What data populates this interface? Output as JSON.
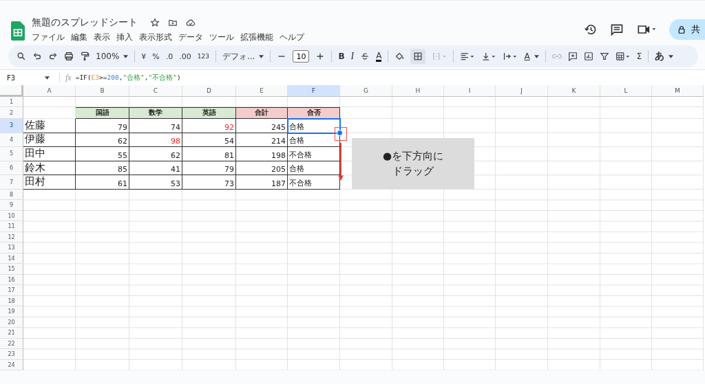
{
  "app": {
    "title": "無題のスプレッドシート",
    "menus": [
      "ファイル",
      "編集",
      "表示",
      "挿入",
      "表示形式",
      "データ",
      "ツール",
      "拡張機能",
      "ヘルプ"
    ],
    "share_label": "共"
  },
  "toolbar": {
    "zoom": "100%",
    "currency": "¥",
    "percent": "%",
    "decrease_decimal": ".0",
    "increase_decimal": ".00",
    "number_format": "123",
    "font": "デフォ...",
    "font_size": "10",
    "bold": "B",
    "italic": "I",
    "text_color": "A",
    "text_rotation": "A",
    "sum": "Σ",
    "input_mode": "あ"
  },
  "formula_bar": {
    "name_box": "F3",
    "fx": "fx",
    "formula": [
      {
        "kind": "plain",
        "text": "=IF("
      },
      {
        "kind": "reference",
        "text": "E3"
      },
      {
        "kind": "plain",
        "text": ">="
      },
      {
        "kind": "number",
        "text": "200"
      },
      {
        "kind": "plain",
        "text": ","
      },
      {
        "kind": "string",
        "text": "\"合格\""
      },
      {
        "kind": "plain",
        "text": ","
      },
      {
        "kind": "string",
        "text": "\"不合格\""
      },
      {
        "kind": "plain",
        "text": ")"
      }
    ]
  },
  "sheet": {
    "columns": [
      {
        "label": "A",
        "selected": false
      },
      {
        "label": "B",
        "selected": false
      },
      {
        "label": "C",
        "selected": false
      },
      {
        "label": "D",
        "selected": false
      },
      {
        "label": "E",
        "selected": false
      },
      {
        "label": "F",
        "selected": true
      },
      {
        "label": "G",
        "selected": false
      },
      {
        "label": "H",
        "selected": false
      },
      {
        "label": "I",
        "selected": false
      },
      {
        "label": "J",
        "selected": false
      },
      {
        "label": "K",
        "selected": false
      },
      {
        "label": "L",
        "selected": false
      },
      {
        "label": "M",
        "selected": false
      }
    ],
    "rows": [
      {
        "label": "1",
        "selected": false
      },
      {
        "label": "2",
        "selected": false
      },
      {
        "label": "3",
        "selected": true
      },
      {
        "label": "4",
        "selected": false
      },
      {
        "label": "5",
        "selected": false
      },
      {
        "label": "6",
        "selected": false
      },
      {
        "label": "7",
        "selected": false
      },
      {
        "label": "8",
        "selected": false
      },
      {
        "label": "9",
        "selected": false
      },
      {
        "label": "10",
        "selected": false
      },
      {
        "label": "11",
        "selected": false
      },
      {
        "label": "12",
        "selected": false
      },
      {
        "label": "13",
        "selected": false
      },
      {
        "label": "14",
        "selected": false
      },
      {
        "label": "15",
        "selected": false
      },
      {
        "label": "16",
        "selected": false
      },
      {
        "label": "17",
        "selected": false
      },
      {
        "label": "18",
        "selected": false
      },
      {
        "label": "19",
        "selected": false
      },
      {
        "label": "20",
        "selected": false
      },
      {
        "label": "21",
        "selected": false
      },
      {
        "label": "22",
        "selected": false
      },
      {
        "label": "23",
        "selected": false
      },
      {
        "label": "24",
        "selected": false
      }
    ],
    "header": [
      {
        "label": "国語",
        "color": "#d9ead3"
      },
      {
        "label": "数学",
        "color": "#d9ead3"
      },
      {
        "label": "英語",
        "color": "#d9ead3"
      },
      {
        "label": "合計",
        "color": "#f4cccc"
      },
      {
        "label": "合否",
        "color": "#f4cccc"
      }
    ],
    "records": [
      {
        "name": "佐藤",
        "scores": [
          {
            "value": "79",
            "flagged": false
          },
          {
            "value": "74",
            "flagged": false
          },
          {
            "value": "92",
            "flagged": true
          }
        ],
        "total": "245",
        "result": {
          "value": "合格",
          "selected": true
        }
      },
      {
        "name": "伊藤",
        "scores": [
          {
            "value": "62",
            "flagged": false
          },
          {
            "value": "98",
            "flagged": true
          },
          {
            "value": "54",
            "flagged": false
          }
        ],
        "total": "214",
        "result": {
          "value": "合格",
          "selected": false
        }
      },
      {
        "name": "田中",
        "scores": [
          {
            "value": "55",
            "flagged": false
          },
          {
            "value": "62",
            "flagged": false
          },
          {
            "value": "81",
            "flagged": false
          }
        ],
        "total": "198",
        "result": {
          "value": "不合格",
          "selected": false
        }
      },
      {
        "name": "鈴木",
        "scores": [
          {
            "value": "85",
            "flagged": false
          },
          {
            "value": "41",
            "flagged": false
          },
          {
            "value": "79",
            "flagged": false
          }
        ],
        "total": "205",
        "result": {
          "value": "合格",
          "selected": false
        }
      },
      {
        "name": "田村",
        "scores": [
          {
            "value": "61",
            "flagged": false
          },
          {
            "value": "53",
            "flagged": false
          },
          {
            "value": "73",
            "flagged": false
          }
        ],
        "total": "187",
        "result": {
          "value": "不合格",
          "selected": false
        }
      }
    ],
    "callout": [
      "●を下方向に",
      "ドラッグ"
    ]
  }
}
